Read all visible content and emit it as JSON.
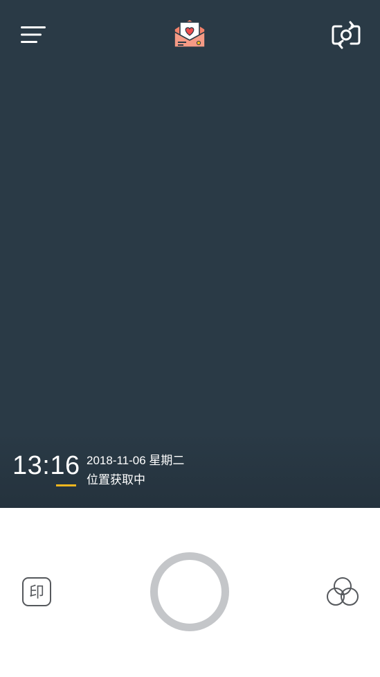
{
  "camera": {
    "watermark": {
      "time": "13:16",
      "date": "2018-11-06 星期二",
      "location": "位置获取中"
    },
    "icons": {
      "menu": "hamburger-menu-icon",
      "mail": "love-letter-envelope-icon",
      "switch_camera": "switch-camera-icon",
      "stamp": "stamp-印-icon",
      "filter": "filter-circles-icon"
    },
    "stamp_glyph": "印",
    "colors": {
      "viewfinder_bg": "#2a3a46",
      "accent_underline": "#f5b71e",
      "shutter_ring": "#c4c6c9",
      "envelope": "#f2826b",
      "heart": "#ef4d4d"
    }
  }
}
